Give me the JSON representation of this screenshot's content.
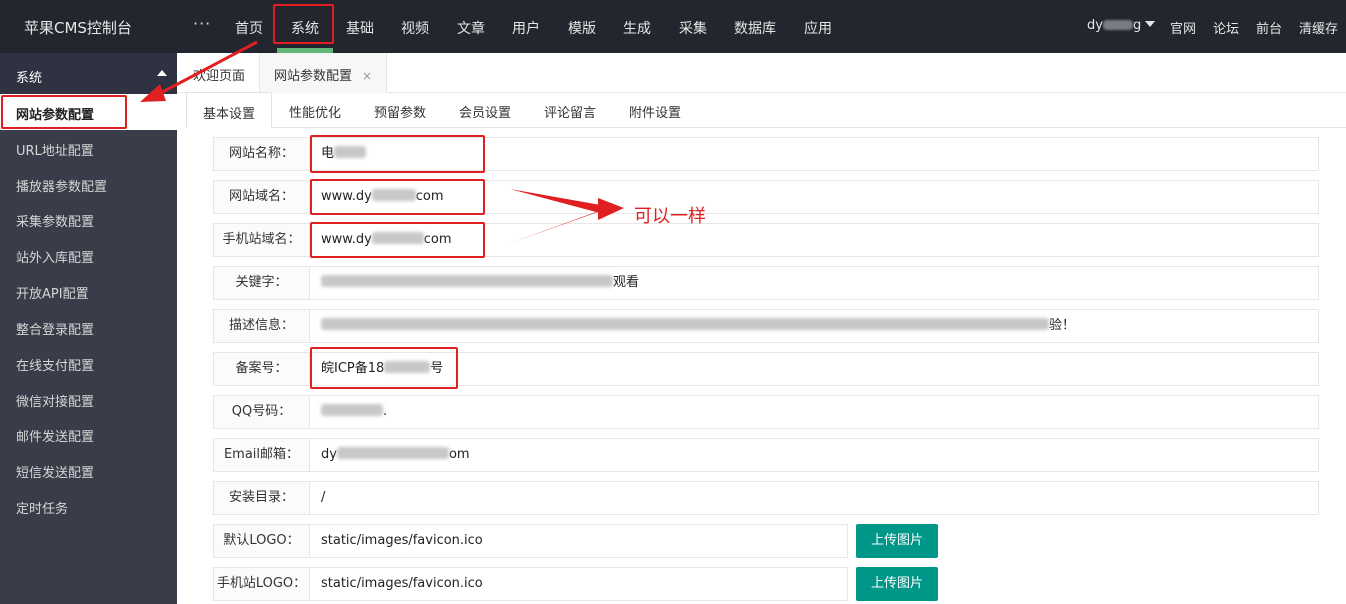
{
  "app": {
    "title": "苹果CMS控制台"
  },
  "topnav": {
    "more": "···",
    "items": [
      {
        "label": "首页"
      },
      {
        "label": "系统"
      },
      {
        "label": "基础"
      },
      {
        "label": "视频"
      },
      {
        "label": "文章"
      },
      {
        "label": "用户"
      },
      {
        "label": "模版"
      },
      {
        "label": "生成"
      },
      {
        "label": "采集"
      },
      {
        "label": "数据库"
      },
      {
        "label": "应用"
      }
    ],
    "active": "系统",
    "user": "dy",
    "user_tail": "g",
    "right_links": [
      {
        "label": "官网"
      },
      {
        "label": "论坛"
      },
      {
        "label": "前台"
      },
      {
        "label": "清缓存"
      }
    ]
  },
  "sidebar": {
    "group": "系统",
    "items": [
      {
        "label": "网站参数配置"
      },
      {
        "label": "URL地址配置"
      },
      {
        "label": "播放器参数配置"
      },
      {
        "label": "采集参数配置"
      },
      {
        "label": "站外入库配置"
      },
      {
        "label": "开放API配置"
      },
      {
        "label": "整合登录配置"
      },
      {
        "label": "在线支付配置"
      },
      {
        "label": "微信对接配置"
      },
      {
        "label": "邮件发送配置"
      },
      {
        "label": "短信发送配置"
      },
      {
        "label": "定时任务"
      }
    ],
    "active": "网站参数配置"
  },
  "page_tabs": [
    {
      "label": "欢迎页面"
    },
    {
      "label": "网站参数配置",
      "close": "×"
    }
  ],
  "settings_tabs": [
    {
      "label": "基本设置"
    },
    {
      "label": "性能优化"
    },
    {
      "label": "预留参数"
    },
    {
      "label": "会员设置"
    },
    {
      "label": "评论留言"
    },
    {
      "label": "附件设置"
    }
  ],
  "form": {
    "site_name": {
      "label": "网站名称：",
      "value": "电"
    },
    "site_domain": {
      "label": "网站域名：",
      "value_prefix": "www.dy",
      "value_suffix": "com"
    },
    "mobile_domain": {
      "label": "手机站域名：",
      "value_prefix": "www.dy",
      "value_suffix": "com"
    },
    "keywords": {
      "label": "关键字：",
      "value_suffix": "观看"
    },
    "description": {
      "label": "描述信息：",
      "value_suffix": "验！"
    },
    "icp": {
      "label": "备案号：",
      "value_prefix": "皖ICP备18",
      "value_suffix": "号"
    },
    "qq": {
      "label": "QQ号码：",
      "value": "."
    },
    "email": {
      "label": "Email邮箱：",
      "value_prefix": "dy",
      "value_suffix": "om"
    },
    "install_dir": {
      "label": "安装目录：",
      "value": "/"
    },
    "default_logo": {
      "label": "默认LOGO：",
      "value": "static/images/favicon.ico",
      "button": "上传图片"
    },
    "mobile_logo": {
      "label": "手机站LOGO：",
      "value": "static/images/favicon.ico",
      "button": "上传图片"
    }
  },
  "annotation": {
    "text": "可以一样"
  },
  "colors": {
    "topbar": "#23262e",
    "sidebar": "#393d49",
    "active_bar": "#5fb878",
    "button": "#009688",
    "annotation_red": "#e02020"
  }
}
